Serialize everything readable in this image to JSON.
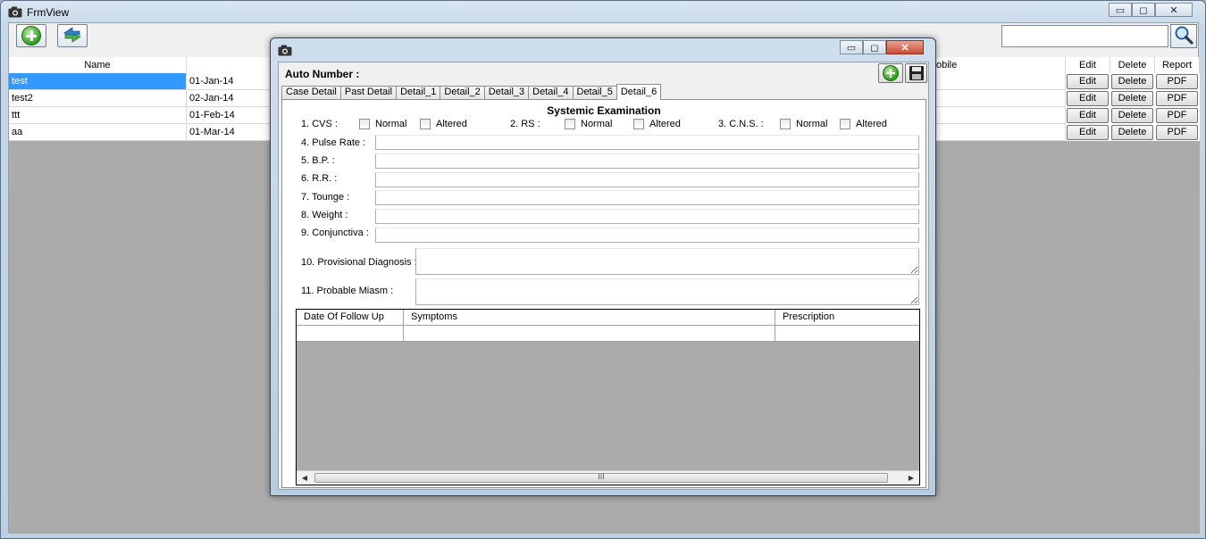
{
  "main_window": {
    "title": "FrmView",
    "controls": {
      "minimize": "▭",
      "maximize": "◻",
      "close": "✕"
    }
  },
  "toolbar": {
    "add_icon": "add-green-circle",
    "refresh_icon": "refresh-arrows",
    "search_value": "",
    "search_icon": "magnifier"
  },
  "grid": {
    "columns": [
      "Name",
      "",
      "obile",
      "Edit",
      "Delete",
      "Report"
    ],
    "rows": [
      {
        "name": "test",
        "date": "01-Jan-14",
        "edit": "Edit",
        "delete": "Delete",
        "report": "PDF",
        "selected": true
      },
      {
        "name": "test2",
        "date": "02-Jan-14",
        "edit": "Edit",
        "delete": "Delete",
        "report": "PDF",
        "selected": false
      },
      {
        "name": "ttt",
        "date": "01-Feb-14",
        "edit": "Edit",
        "delete": "Delete",
        "report": "PDF",
        "selected": false
      },
      {
        "name": "aa",
        "date": "01-Mar-14",
        "edit": "Edit",
        "delete": "Delete",
        "report": "PDF",
        "selected": false
      }
    ]
  },
  "dialog": {
    "title": "",
    "controls": {
      "minimize": "▭",
      "maximize": "◻",
      "close": "✕"
    },
    "auto_number_label": "Auto Number :",
    "tabs": [
      "Case Detail",
      "Past Detail",
      "Detail_1",
      "Detail_2",
      "Detail_3",
      "Detail_4",
      "Detail_5",
      "Detail_6"
    ],
    "active_tab": "Detail_6",
    "section_title": "Systemic Examination",
    "exam": {
      "cvs": "1. CVS :",
      "rs": "2. RS :",
      "cns": "3. C.N.S. :",
      "normal": "Normal",
      "altered": "Altered"
    },
    "fields": [
      {
        "label": "4. Pulse Rate :",
        "value": ""
      },
      {
        "label": "5. B.P. :",
        "value": ""
      },
      {
        "label": "6. R.R. :",
        "value": ""
      },
      {
        "label": "7. Tounge :",
        "value": ""
      },
      {
        "label": "8. Weight :",
        "value": ""
      },
      {
        "label": "9. Conjunctiva :",
        "value": ""
      }
    ],
    "long_fields": [
      {
        "label": "10. Provisional Diagnosis :",
        "value": ""
      },
      {
        "label": "11. Probable Miasm :",
        "value": ""
      }
    ],
    "followup_grid": {
      "columns": [
        "Date Of Follow Up",
        "Symptoms",
        "Prescription"
      ],
      "scroll_thumb_grip": "III"
    }
  }
}
